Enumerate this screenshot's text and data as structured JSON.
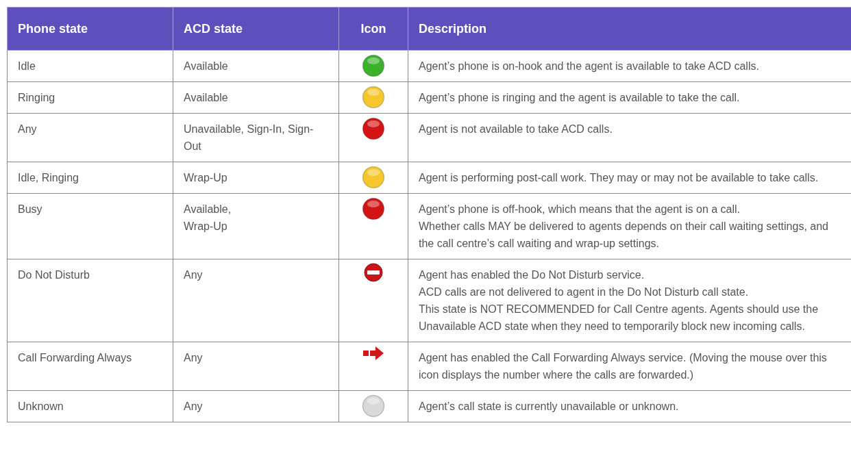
{
  "table": {
    "columns": [
      "Phone state",
      "ACD state",
      "Icon",
      "Description"
    ],
    "rows": [
      {
        "phone_state": "Idle",
        "acd_state": "Available",
        "icon": {
          "kind": "circle",
          "color": "#3cb22c"
        },
        "description": "Agent’s phone is on-hook and the agent is available to take ACD calls."
      },
      {
        "phone_state": "Ringing",
        "acd_state": "Available",
        "icon": {
          "kind": "circle",
          "color": "#f6c72c"
        },
        "description": "Agent’s phone is ringing and the agent is available to take the call."
      },
      {
        "phone_state": "Any",
        "acd_state": "Unavailable, Sign-In, Sign- Out",
        "icon": {
          "kind": "circle",
          "color": "#d41414"
        },
        "description": "Agent is not available to take ACD calls."
      },
      {
        "phone_state": "Idle, Ringing",
        "acd_state": "Wrap-Up",
        "icon": {
          "kind": "circle",
          "color": "#f6c72c"
        },
        "description": "Agent is performing post-call work. They may or may not be available to take calls."
      },
      {
        "phone_state": "Busy",
        "acd_state": "Available,\nWrap-Up",
        "icon": {
          "kind": "circle",
          "color": "#d41414"
        },
        "description": "Agent’s phone is off-hook, which means that the agent is on a call.\nWhether calls MAY be delivered to agents depends on their call waiting settings, and the call centre’s call waiting and wrap-up settings."
      },
      {
        "phone_state": "Do Not Disturb",
        "acd_state": "Any",
        "icon": {
          "kind": "no-entry"
        },
        "description": "Agent has enabled the Do Not Disturb service.\nACD calls are not delivered to agent in the Do Not Disturb call state.\nThis state is NOT RECOMMENDED for Call Centre agents. Agents should use the Unavailable ACD state when they need to temporarily block new incoming calls."
      },
      {
        "phone_state": "Call Forwarding Always",
        "acd_state": "Any",
        "icon": {
          "kind": "forward"
        },
        "description": "Agent has enabled the Call Forwarding Always service. (Moving the mouse over this icon displays the number where the calls are forwarded.)"
      },
      {
        "phone_state": "Unknown",
        "acd_state": "Any",
        "icon": {
          "kind": "circle",
          "color": "#d9d9d9"
        },
        "description": "Agent’s call state is currently unavailable or unknown."
      }
    ]
  }
}
